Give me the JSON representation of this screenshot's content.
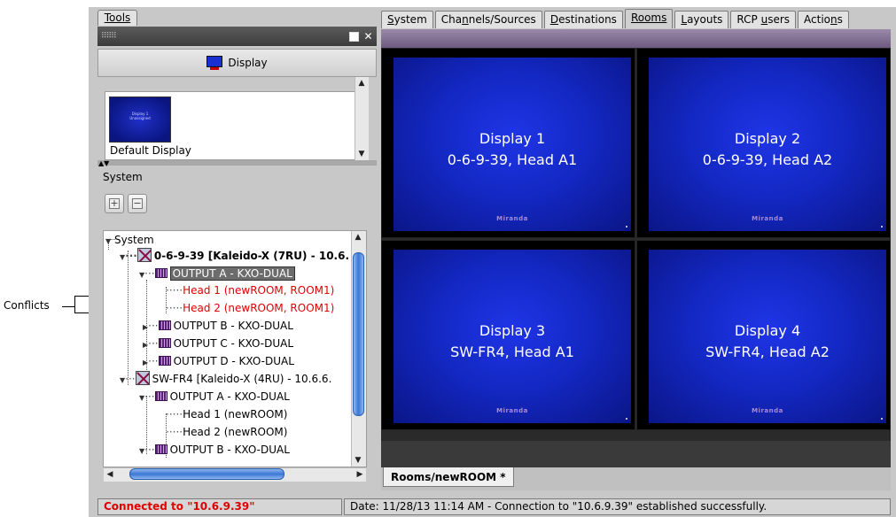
{
  "annotation": {
    "label": "Conflicts"
  },
  "tools_tab": {
    "label": "Tools"
  },
  "palette": {
    "display_button": "Display",
    "items": [
      {
        "thumb_line1": "Display 1",
        "thumb_line2": "Unassigned",
        "label": "Default Display"
      }
    ]
  },
  "system_panel": {
    "label": "System",
    "add_button_icon": "plus-icon",
    "remove_button_icon": "minus-icon"
  },
  "tree": {
    "root": "System",
    "nodes": [
      {
        "label": "0-6-9-39 [Kaleido-X (7RU) - 10.6.",
        "style": "bold"
      },
      {
        "label": "OUTPUT A - KXO-DUAL",
        "style": "selected"
      },
      {
        "label": "Head 1 (newROOM, ROOM1)",
        "style": "conflict"
      },
      {
        "label": "Head 2 (newROOM, ROOM1)",
        "style": "conflict"
      },
      {
        "label": "OUTPUT B - KXO-DUAL",
        "style": "normal"
      },
      {
        "label": "OUTPUT C - KXO-DUAL",
        "style": "normal"
      },
      {
        "label": "OUTPUT D - KXO-DUAL",
        "style": "normal"
      },
      {
        "label": "SW-FR4 [Kaleido-X (4RU) - 10.6.6.",
        "style": "normal"
      },
      {
        "label": "OUTPUT A - KXO-DUAL",
        "style": "normal"
      },
      {
        "label": "Head 1 (newROOM)",
        "style": "normal"
      },
      {
        "label": "Head 2 (newROOM)",
        "style": "normal"
      },
      {
        "label": "OUTPUT B - KXO-DUAL",
        "style": "normal"
      }
    ]
  },
  "tabs": [
    {
      "pre": "",
      "u": "S",
      "post": "ystem"
    },
    {
      "pre": "Cha",
      "u": "n",
      "post": "nels/Sources"
    },
    {
      "pre": "",
      "u": "D",
      "post": "estinations"
    },
    {
      "pre": "",
      "u": "Rooms",
      "post": ""
    },
    {
      "pre": "",
      "u": "L",
      "post": "ayouts"
    },
    {
      "pre": "RCP ",
      "u": "u",
      "post": "sers"
    },
    {
      "pre": "Actio",
      "u": "n",
      "post": "s"
    }
  ],
  "active_tab_index": 3,
  "room": {
    "brand": "Miranda",
    "displays": [
      {
        "line1": "Display 1",
        "line2": "0-6-9-39, Head A1"
      },
      {
        "line1": "Display 2",
        "line2": "0-6-9-39, Head A2"
      },
      {
        "line1": "Display 3",
        "line2": "SW-FR4, Head A1"
      },
      {
        "line1": "Display 4",
        "line2": "SW-FR4, Head A2"
      }
    ],
    "document_tab": "Rooms/newROOM *"
  },
  "status": {
    "connection": "Connected to \"10.6.9.39\"",
    "message": "Date: 11/28/13 11:14 AM - Connection to \"10.6.9.39\" established successfully."
  }
}
